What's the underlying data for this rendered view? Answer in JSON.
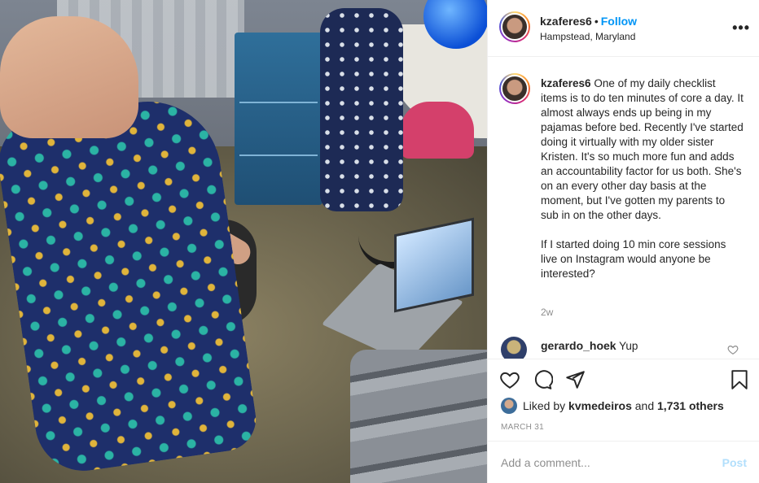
{
  "post": {
    "photo_alt": "",
    "header": {
      "username": "kzaferes6",
      "separator": "•",
      "follow_label": "Follow",
      "location": "Hampstead, Maryland",
      "more_icon": "more-horizontal-icon"
    },
    "caption": {
      "username": "kzaferes6",
      "text": "One of my daily checklist items is to do ten minutes of core a day. It almost always ends up being in my pajamas before bed. Recently I've started doing it virtually with my older sister Kristen. It's so much more fun and adds an accountability factor for us both. She's on an every other day basis at the moment, but I've gotten my parents to sub in on the other days.\n\nIf I started doing 10 min core sessions live on Instagram would anyone be interested?",
      "time_ago": "2w"
    },
    "comments": [
      {
        "username": "gerardo_hoek",
        "text": "Yup"
      }
    ],
    "actions": {
      "like_icon": "heart-icon",
      "comment_icon": "comment-icon",
      "share_icon": "send-icon",
      "save_icon": "bookmark-icon"
    },
    "likes": {
      "prefix": "Liked by",
      "first_user": "kvmedeiros",
      "connector": "and",
      "others": "1,731 others"
    },
    "date": "MARCH 31",
    "add_comment": {
      "placeholder": "Add a comment...",
      "post_label": "Post"
    },
    "colors": {
      "follow_blue": "#0095f6",
      "post_disabled": "#b2dffc",
      "muted": "#8e8e8e",
      "text": "#262626"
    }
  }
}
